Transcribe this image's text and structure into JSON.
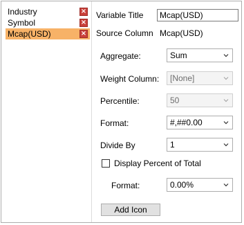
{
  "variables": {
    "items": [
      {
        "label": "Industry",
        "selected": false
      },
      {
        "label": "Symbol",
        "selected": false
      },
      {
        "label": "Mcap(USD)",
        "selected": true
      }
    ],
    "remove_icon": "close-icon"
  },
  "form": {
    "variable_title_label": "Variable Title",
    "variable_title_value": "Mcap(USD)",
    "source_column_label": "Source Column",
    "source_column_value": "Mcap(USD)",
    "aggregate_label": "Aggregate:",
    "aggregate_value": "Sum",
    "weight_column_label": "Weight Column:",
    "weight_column_value": "[None]",
    "percentile_label": "Percentile:",
    "percentile_value": "50",
    "format_label": "Format:",
    "format_value": "#,##0.00",
    "divide_by_label": "Divide By",
    "divide_by_value": "1",
    "display_percent_label": "Display Percent of Total",
    "display_percent_checked": false,
    "percent_format_label": "Format:",
    "percent_format_value": "0.00%",
    "add_icon_label": "Add Icon"
  },
  "colors": {
    "selected_row": "#f7b267",
    "remove_button": "#c9403a"
  }
}
